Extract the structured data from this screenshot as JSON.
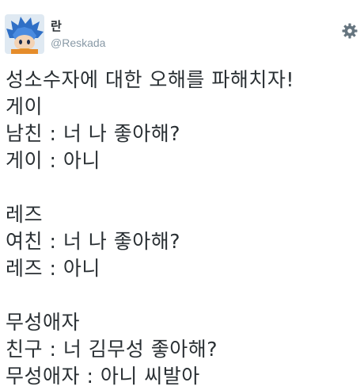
{
  "author": {
    "display_name": "란",
    "username": "@Reskada"
  },
  "icons": {
    "settings": "gear-icon",
    "avatar": "blue-haired-character-avatar"
  },
  "colors": {
    "text": "#292f33",
    "muted": "#8899a6",
    "gear": "#66757f"
  },
  "tweet": {
    "lines": [
      "성소수자에 대한 오해를 파해치자!",
      "게이",
      "남친 : 너 나 좋아해?",
      "게이 : 아니",
      "",
      "레즈",
      "여친 : 너 나 좋아해?",
      "레즈 : 아니",
      "",
      "무성애자",
      "친구 : 너 김무성 좋아해?",
      "무성애자 : 아니 씨발아"
    ]
  }
}
